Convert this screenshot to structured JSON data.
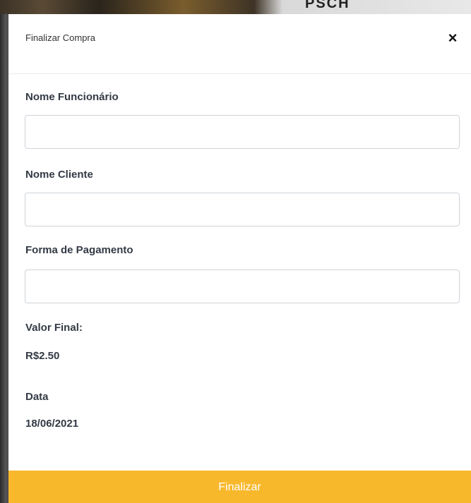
{
  "backdrop": {
    "text": "PSCH"
  },
  "modal": {
    "title": "Finalizar Compra",
    "close_icon": "×",
    "fields": {
      "funcionario": {
        "label": "Nome Funcionário",
        "value": "",
        "placeholder": ""
      },
      "cliente": {
        "label": "Nome Cliente",
        "value": "",
        "placeholder": ""
      },
      "pagamento": {
        "label": "Forma de Pagamento",
        "value": "",
        "placeholder": ""
      }
    },
    "valor_final": {
      "label": "Valor Final:",
      "value": "R$2.50"
    },
    "data": {
      "label": "Data",
      "value": "18/06/2021"
    },
    "submit_label": "Finalizar"
  },
  "colors": {
    "accent": "#f8b82c",
    "text": "#333a45",
    "border": "#ced4da"
  }
}
